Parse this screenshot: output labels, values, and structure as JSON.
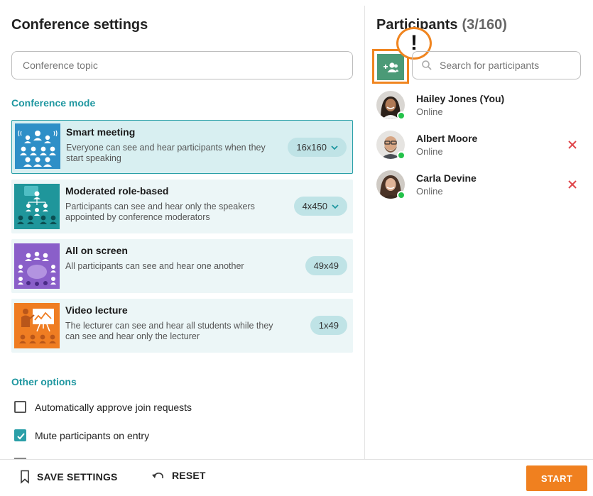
{
  "conference": {
    "title": "Conference settings",
    "topic_placeholder": "Conference topic",
    "mode_section": "Conference mode",
    "modes": [
      {
        "title": "Smart meeting",
        "desc": "Everyone can see and hear participants when they start speaking",
        "limit": "16x160",
        "selected": true,
        "has_dropdown": true,
        "color": "#2e8fc7"
      },
      {
        "title": "Moderated role-based",
        "desc": "Participants can see and hear only the speakers appointed by conference moderators",
        "limit": "4x450",
        "selected": false,
        "has_dropdown": true,
        "color": "#1f969b"
      },
      {
        "title": "All on screen",
        "desc": "All participants can see and hear one another",
        "limit": "49x49",
        "selected": false,
        "has_dropdown": false,
        "color": "#8a5fc9"
      },
      {
        "title": "Video lecture",
        "desc": "The lecturer can see and hear all students while they can see and hear only the lecturer",
        "limit": "1x49",
        "selected": false,
        "has_dropdown": false,
        "color": "#ef7d22"
      }
    ],
    "other_section": "Other options",
    "options": [
      {
        "label": "Automatically approve join requests",
        "checked": false
      },
      {
        "label": "Mute participants on entry",
        "checked": true
      }
    ]
  },
  "participants": {
    "title": "Participants",
    "count": "(3/160)",
    "search_placeholder": "Search for participants",
    "add_button_icon": "add-group-icon",
    "alert_mark": "!",
    "list": [
      {
        "name": "Hailey Jones (You)",
        "status": "Online",
        "removable": false
      },
      {
        "name": "Albert Moore",
        "status": "Online",
        "removable": true
      },
      {
        "name": "Carla Devine",
        "status": "Online",
        "removable": true
      }
    ]
  },
  "footer": {
    "save_label": "SAVE SETTINGS",
    "reset_label": "RESET",
    "start_label": "START"
  },
  "colors": {
    "accent": "#1f97a0",
    "start": "#f0801f",
    "highlight": "#f08520",
    "online": "#24c24a",
    "remove": "#e0474c"
  }
}
